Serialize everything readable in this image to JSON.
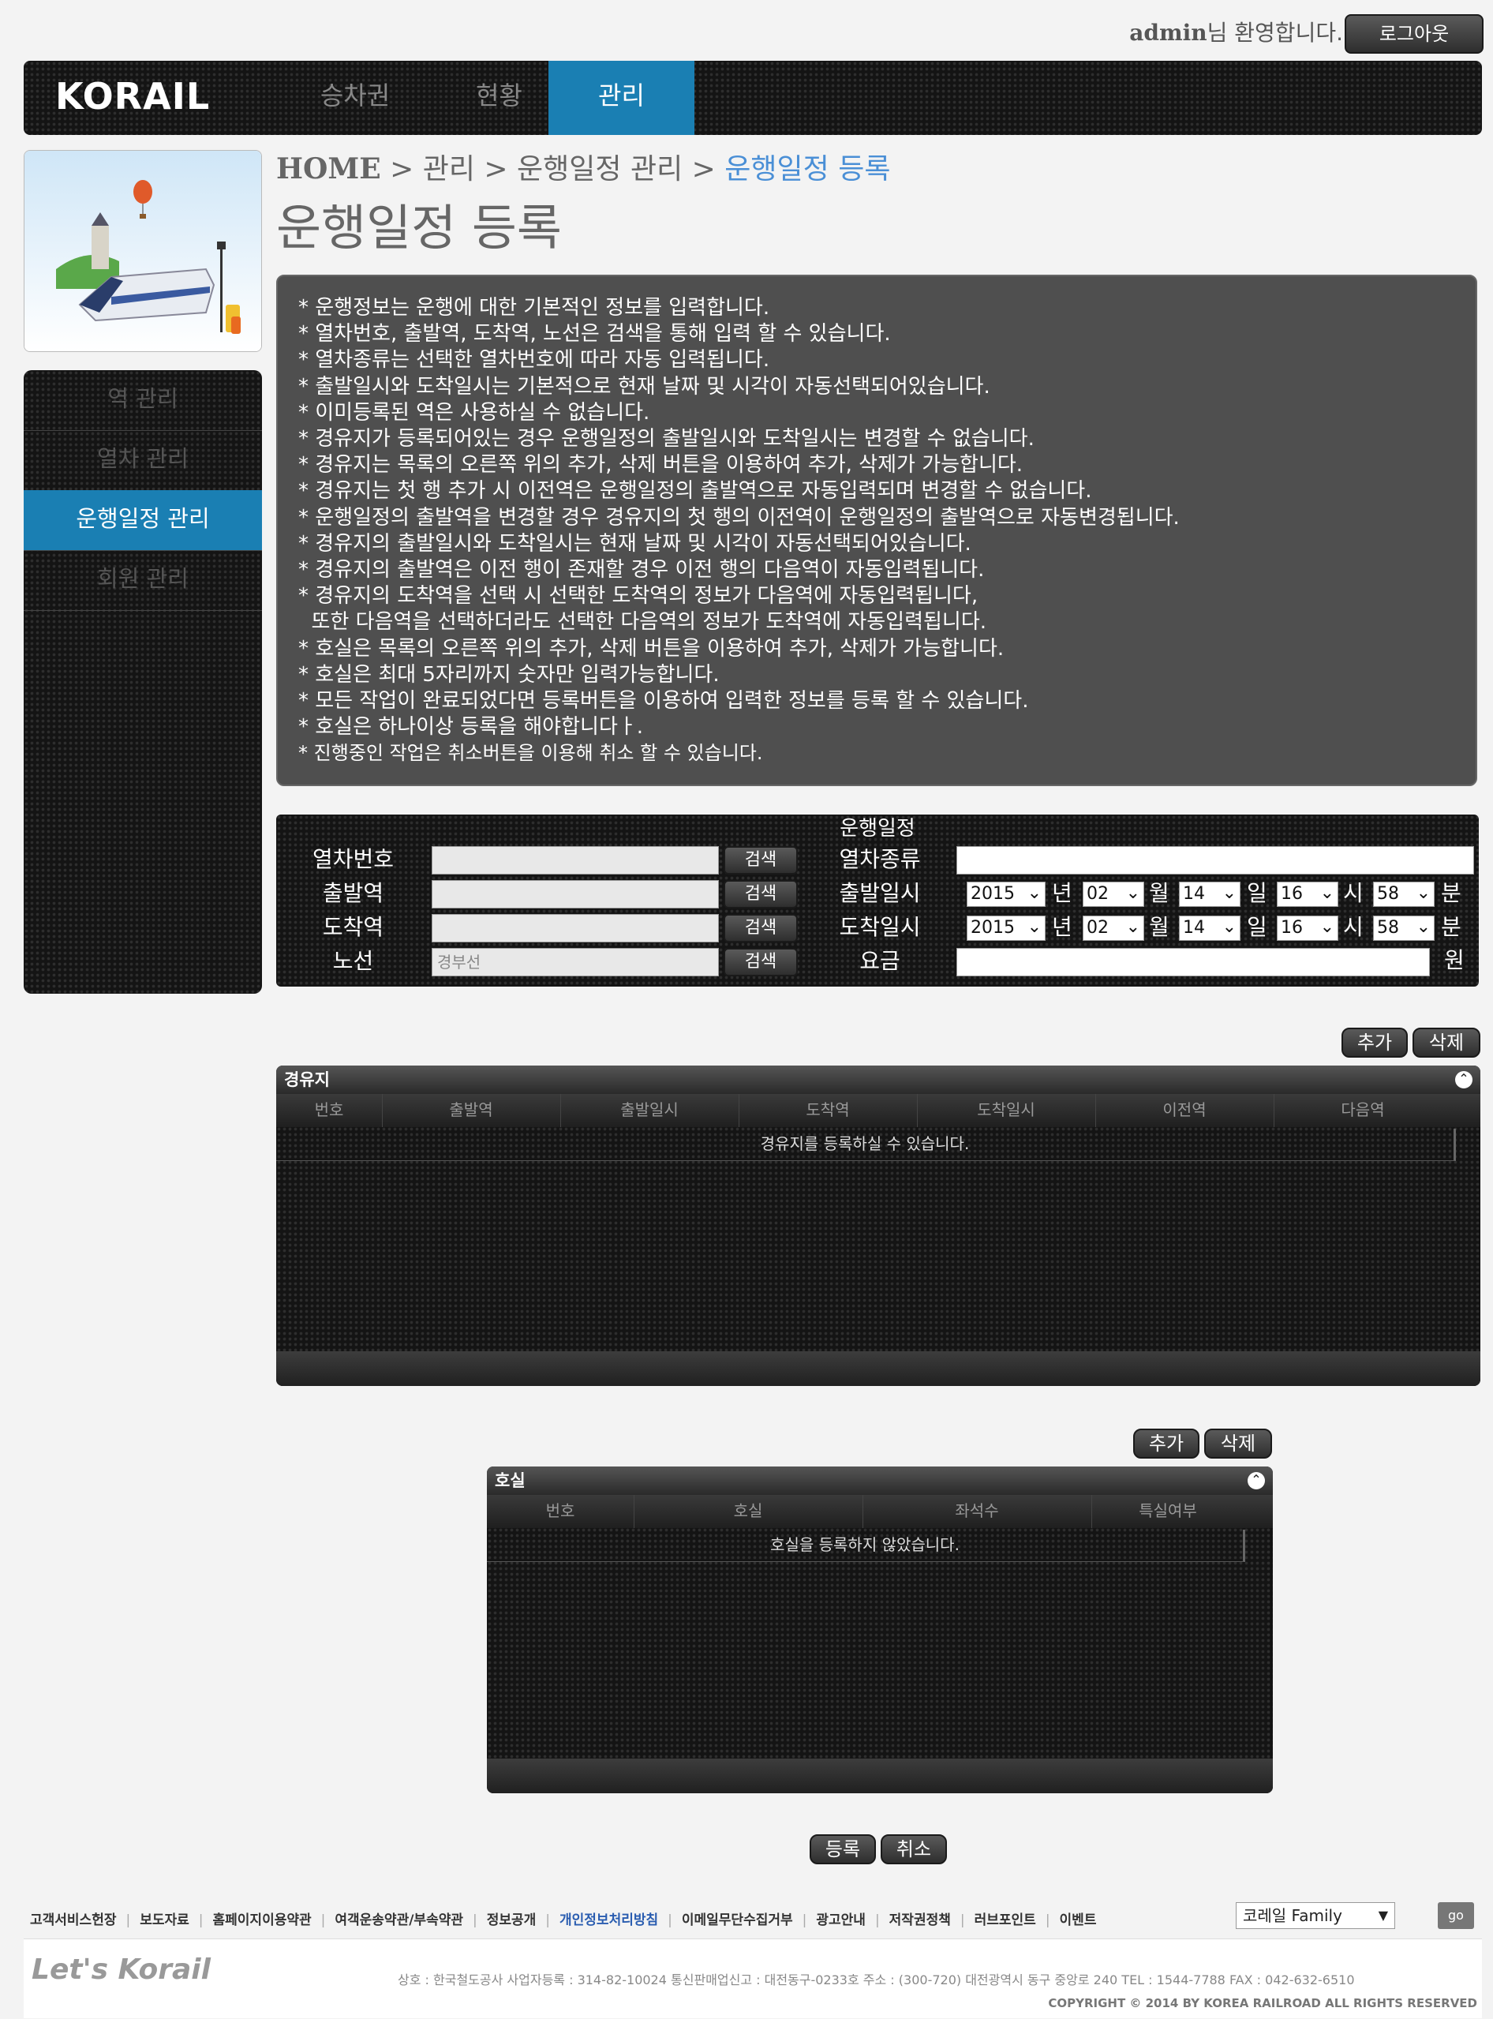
{
  "header": {
    "welcome_user": "admin",
    "welcome_suffix": "님 환영합니다.",
    "logout_label": "로그아웃",
    "logo_text": "KORAIL",
    "nav_tabs": [
      "승차권",
      "현황",
      "관리"
    ]
  },
  "sidebar": {
    "items": [
      "역 관리",
      "열차 관리",
      "운행일정 관리",
      "회원 관리"
    ]
  },
  "breadcrumb": {
    "home": "HOME",
    "sep": " > ",
    "level1": "관리",
    "level2": "운행일정 관리",
    "current": "운행일정 등록"
  },
  "page_title": "운행일정 등록",
  "info_lines": [
    "* 운행정보는 운행에 대한 기본적인 정보를 입력합니다.",
    "* 열차번호, 출발역, 도착역, 노선은 검색을 통해 입력 할 수 있습니다.",
    "* 열차종류는 선택한 열차번호에 따라 자동 입력됩니다.",
    "* 출발일시와 도착일시는 기본적으로 현재 날짜 및 시각이 자동선택되어있습니다.",
    "* 이미등록된 역은 사용하실 수 없습니다.",
    "* 경유지가 등록되어있는 경우 운행일정의 출발일시와 도착일시는 변경할 수 없습니다.",
    "* 경유지는 목록의 오른쪽 위의 추가, 삭제 버튼을 이용하여 추가, 삭제가 가능합니다.",
    "* 경유지는 첫 행 추가 시 이전역은 운행일정의 출발역으로 자동입력되며 변경할 수 없습니다.",
    "* 운행일정의 출발역을 변경할 경우 경유지의 첫 행의 이전역이 운행일정의 출발역으로 자동변경됩니다.",
    "* 경유지의 출발일시와 도착일시는 현재 날짜 및 시각이 자동선택되어있습니다.",
    "* 경유지의 출발역은 이전 행이 존재할 경우 이전 행의 다음역이 자동입력됩니다.",
    "* 경유지의 도착역을 선택 시 선택한 도착역의 정보가 다음역에 자동입력됩니다,",
    "  또한 다음역을 선택하더라도 선택한 다음역의 정보가 도착역에 자동입력됩니다.",
    "* 호실은 목록의 오른쪽 위의 추가, 삭제 버튼을 이용하여 추가, 삭제가 가능합니다.",
    "* 호실은 최대 5자리까지 숫자만 입력가능합니다.",
    "* 모든 작업이 완료되었다면 등록버튼을 이용하여 입력한 정보를 등록 할 수 있습니다.",
    "* 호실은 하나이상 등록을 해야합니다ㅏ.",
    "* 진행중인 작업은 취소버튼을 이용해 취소 할 수 있습니다."
  ],
  "form": {
    "title": "운행일정",
    "train_no_label": "열차번호",
    "train_type_label": "열차종류",
    "dep_station_label": "출발역",
    "dep_time_label": "출발일시",
    "arr_station_label": "도착역",
    "arr_time_label": "도착일시",
    "route_label": "노선",
    "route_placeholder": "경부선",
    "fare_label": "요금",
    "fare_unit": "원",
    "search_label": "검색",
    "year": "2015",
    "month": "02",
    "day": "14",
    "hour": "16",
    "minute": "58",
    "unit_year": "년",
    "unit_month": "월",
    "unit_day": "일",
    "unit_hour": "시",
    "unit_minute": "분"
  },
  "waypoints": {
    "add_label": "추가",
    "delete_label": "삭제",
    "title": "경유지",
    "columns": [
      "번호",
      "출발역",
      "출발일시",
      "도착역",
      "도착일시",
      "이전역",
      "다음역"
    ],
    "empty_text": "경유지를 등록하실 수 있습니다."
  },
  "rooms": {
    "add_label": "추가",
    "delete_label": "삭제",
    "title": "호실",
    "columns": [
      "번호",
      "호실",
      "좌석수",
      "특실여부"
    ],
    "empty_text": "호실을 등록하지 않았습니다."
  },
  "actions": {
    "register_label": "등록",
    "cancel_label": "취소"
  },
  "footer": {
    "links": [
      "고객서비스헌장",
      "보도자료",
      "홈페이지이용약관",
      "여객운송약관/부속약관",
      "정보공개",
      "개인정보처리방침",
      "이메일무단수집거부",
      "광고안내",
      "저작권정책",
      "러브포인트",
      "이벤트"
    ],
    "family_select": "코레일 Family",
    "go_label": "go",
    "brand": "Let's Korail",
    "address": "상호 : 한국철도공사    사업자등록 : 314-82-10024    통신판매업신고 : 대전동구-0233호    주소 : (300-720) 대전광역시 동구 중앙로 240    TEL : 1544-7788    FAX : 042-632-6510",
    "copyright": "COPYRIGHT © 2014 BY KOREA RAILROAD  ALL RIGHTS RESERVED"
  },
  "colors": {
    "accent": "#1a7fb3",
    "breadcrumb_current": "#4a8fd6",
    "info_bg": "#4f4f4f"
  }
}
